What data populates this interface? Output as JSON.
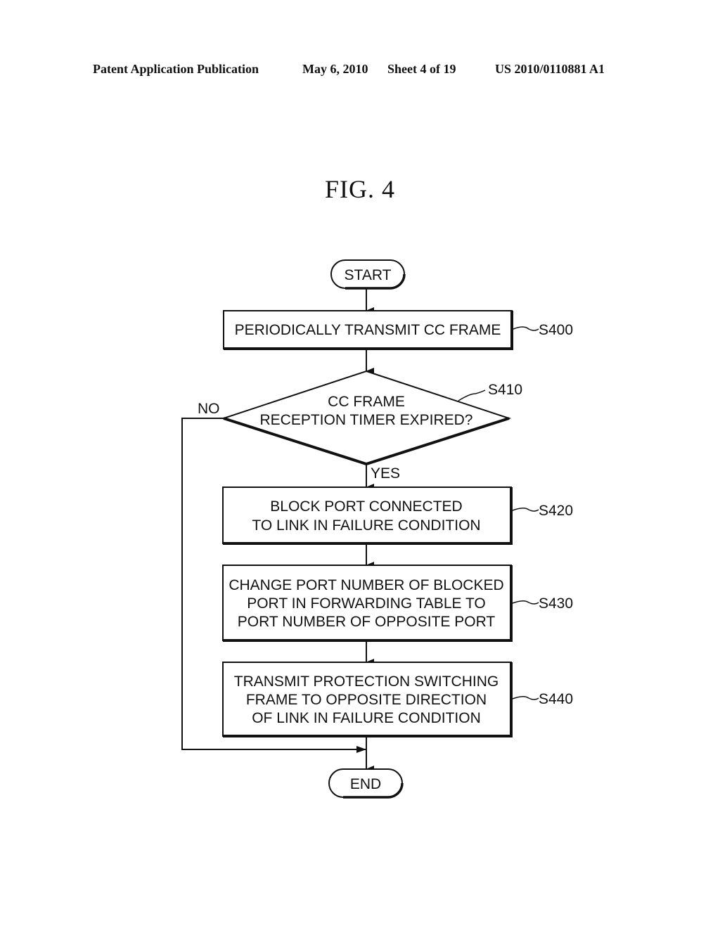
{
  "header": {
    "publication": "Patent Application Publication",
    "date": "May 6, 2010",
    "sheet": "Sheet 4 of 19",
    "number": "US 2010/0110881 A1"
  },
  "figure": {
    "title": "FIG. 4"
  },
  "flowchart": {
    "start": "START",
    "end": "END",
    "steps": [
      {
        "id": "S400",
        "lines": [
          "PERIODICALLY TRANSMIT CC FRAME"
        ]
      },
      {
        "id": "S410",
        "lines": [
          "CC FRAME",
          "RECEPTION TIMER EXPIRED?"
        ],
        "type": "decision",
        "yes": "YES",
        "no": "NO"
      },
      {
        "id": "S420",
        "lines": [
          "BLOCK PORT CONNECTED",
          "TO LINK IN FAILURE CONDITION"
        ]
      },
      {
        "id": "S430",
        "lines": [
          "CHANGE PORT NUMBER OF BLOCKED",
          "PORT IN FORWARDING TABLE TO",
          "PORT NUMBER OF OPPOSITE PORT"
        ]
      },
      {
        "id": "S440",
        "lines": [
          "TRANSMIT PROTECTION SWITCHING",
          "FRAME TO OPPOSITE DIRECTION",
          "OF LINK IN FAILURE CONDITION"
        ]
      }
    ]
  }
}
